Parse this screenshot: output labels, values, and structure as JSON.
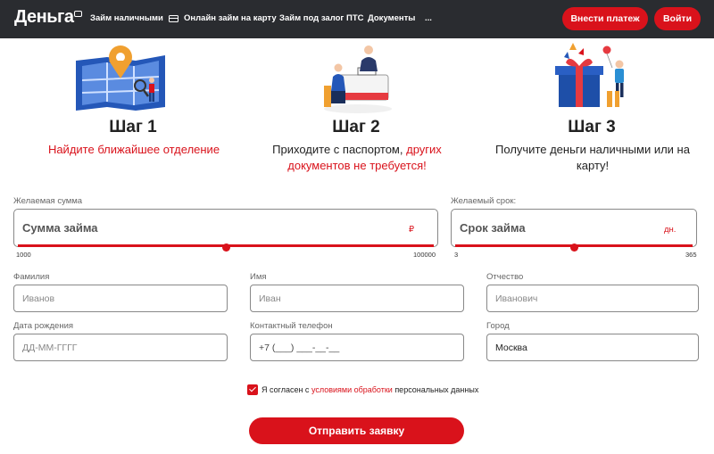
{
  "header": {
    "logo": "Деньга",
    "nav": [
      {
        "label": "Займ наличными"
      },
      {
        "label": "Онлайн займ на карту"
      },
      {
        "label": "Займ под залог ПТС"
      },
      {
        "label": "Документы"
      },
      {
        "label": "..."
      }
    ],
    "pay_button": "Внести платеж",
    "login_button": "Войти"
  },
  "steps": [
    {
      "title": "Шаг 1",
      "desc_line1_red": "Найдите ближайшее отделение",
      "icon": "map-pin-icon"
    },
    {
      "title": "Шаг 2",
      "desc_line1": "Приходите с паспортом,",
      "desc_line1_red": "других",
      "desc_line2_red": "документов не требуется!",
      "icon": "office-desk-icon"
    },
    {
      "title": "Шаг 3",
      "desc_line1": "Получите деньги наличными или на",
      "desc_line2": "карту!",
      "icon": "gift-icon"
    }
  ],
  "form": {
    "amount": {
      "label": "Желаемая сумма",
      "placeholder": "Сумма займа",
      "unit": "₽",
      "min": "1000",
      "max": "100000",
      "position": 0.5
    },
    "term": {
      "label": "Желаемый срок:",
      "placeholder": "Срок займа",
      "unit": "дн.",
      "min": "3",
      "max": "365",
      "position": 0.5
    },
    "last_name": {
      "label": "Фамилия",
      "placeholder": "Иванов"
    },
    "first_name": {
      "label": "Имя",
      "placeholder": "Иван"
    },
    "patronymic": {
      "label": "Отчество",
      "placeholder": "Иванович"
    },
    "birth_date": {
      "label": "Дата рождения",
      "placeholder": "ДД-ММ-ГГГГ"
    },
    "phone": {
      "label": "Контактный телефон",
      "value": "+7 (___) ___-__-__"
    },
    "city": {
      "label": "Город",
      "value": "Москва"
    },
    "consent": {
      "before": "Я согласен с ",
      "link": "условиями обработки",
      "after": " персональных данных",
      "checked": true
    },
    "submit": "Отправить заявку"
  },
  "colors": {
    "accent": "#d9121b",
    "header_bg": "#2a2c30"
  }
}
